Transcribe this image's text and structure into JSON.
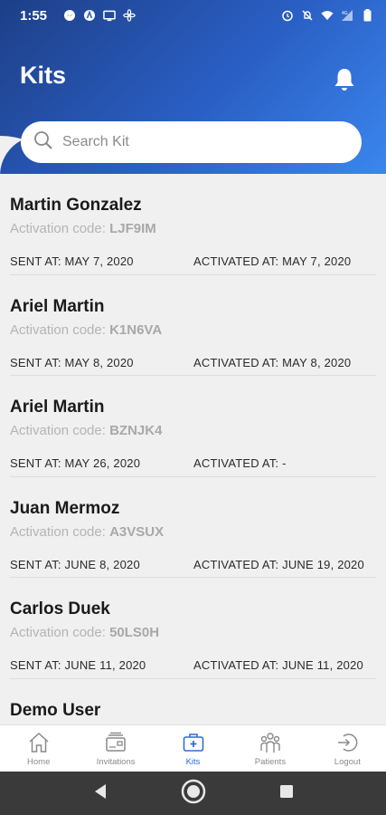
{
  "status_bar": {
    "time": "1:55",
    "network": "4G"
  },
  "header": {
    "title": "Kits"
  },
  "search": {
    "placeholder": "Search Kit"
  },
  "kits": [
    {
      "name": "Martin Gonzalez",
      "code_label": "Activation code:",
      "code": "LJF9IM",
      "sent": "SENT AT: MAY 7, 2020",
      "activated": "ACTIVATED AT: MAY 7, 2020"
    },
    {
      "name": "Ariel Martin",
      "code_label": "Activation code:",
      "code": "K1N6VA",
      "sent": "SENT AT: MAY 8, 2020",
      "activated": "ACTIVATED AT: MAY 8, 2020"
    },
    {
      "name": "Ariel Martin",
      "code_label": "Activation code:",
      "code": "BZNJK4",
      "sent": "SENT AT: MAY 26, 2020",
      "activated": "ACTIVATED AT: -"
    },
    {
      "name": "Juan Mermoz",
      "code_label": "Activation code:",
      "code": "A3VSUX",
      "sent": "SENT AT: JUNE 8, 2020",
      "activated": "ACTIVATED AT: JUNE 19, 2020"
    },
    {
      "name": "Carlos Duek",
      "code_label": "Activation code:",
      "code": "50LS0H",
      "sent": "SENT AT: JUNE 11, 2020",
      "activated": "ACTIVATED AT: JUNE 11, 2020"
    },
    {
      "name": "Demo User",
      "code_label": "",
      "code": "",
      "sent": "",
      "activated": ""
    }
  ],
  "nav": {
    "items": [
      {
        "label": "Home",
        "icon": "home-icon"
      },
      {
        "label": "Invitations",
        "icon": "invitations-icon"
      },
      {
        "label": "Kits",
        "icon": "medical-kit-icon"
      },
      {
        "label": "Patients",
        "icon": "patients-icon"
      },
      {
        "label": "Logout",
        "icon": "logout-icon"
      }
    ],
    "active": "Kits"
  },
  "colors": {
    "header_start": "#1e3f87",
    "header_end": "#3b86ee",
    "accent": "#2f6fd6"
  }
}
